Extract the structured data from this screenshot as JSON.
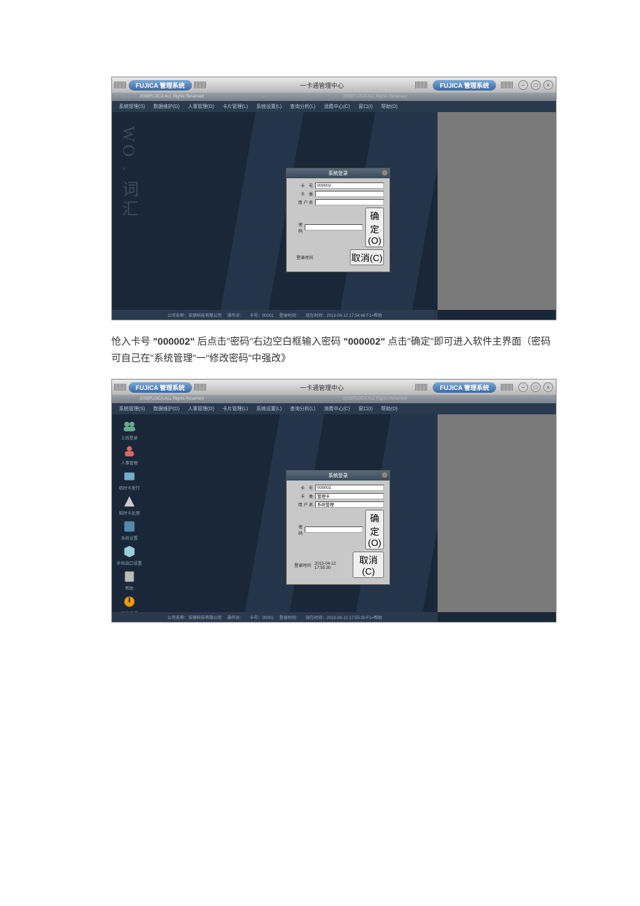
{
  "titlebar": {
    "brand_left": "FUJICA 管理系统",
    "center_title": "一卡通管理中心",
    "brand_right": "FUJICA 管理系统",
    "copyright": "2008FUJICA ALL Rights Reserved"
  },
  "menu": [
    "系统管理(S)",
    "数据维护(D)",
    "人事管理(D)",
    "卡片管理(L)",
    "系统设置(L)",
    "查询分析(L)",
    "消费中心(C)",
    "窗口(I)",
    "帮助(D)"
  ],
  "menu2": [
    "系统管理(S)",
    "数据维护(D)",
    "人事管理(D)",
    "卡片管理(L)",
    "系统设置(L)",
    "查询分析(L)",
    "消费中心(C)",
    "窗口(I)",
    "帮助(D)"
  ],
  "login": {
    "title": "系统登录",
    "fields": {
      "card_no_label": "卡　号",
      "card_no_value": "000002",
      "card_name_label": "卡　类",
      "card_name_value1": "",
      "card_name_value2": "管理卡",
      "user_label": "用 户 名",
      "user_value1": "",
      "user_value2": "系统管理",
      "pwd_label": "密　码",
      "pwd_value": "",
      "login_time_label": "登录时间",
      "login_time_value": "2013-04-12 17:55:30"
    },
    "btn_ok": "确定(O)",
    "btn_cancel": "取消(C)"
  },
  "sidebar": [
    {
      "label": "上线登录"
    },
    {
      "label": "人事管理"
    },
    {
      "label": "临时卡发行"
    },
    {
      "label": "临时卡处理"
    },
    {
      "label": "系统设置"
    },
    {
      "label": "补贴出口设置"
    },
    {
      "label": "帮助"
    },
    {
      "label": "退出系统"
    }
  ],
  "status": {
    "company": "公司名称：安德科技有限公司",
    "op": "操作员：",
    "card": "卡号：00001",
    "login": "登录时间：",
    "time": "现在时间：2013-04-12 17:54:46  F1=帮助"
  },
  "status2": {
    "company": "公司名称：安德科技有限公司",
    "op": "操作员：",
    "card": "卡号：00001",
    "login": "登录时间：",
    "time": "现在时间：2013-04-12 17:55:30  F1=帮助"
  },
  "instruction": {
    "t1": "怆入卡号",
    "v1": "\"000002\"",
    "t2": "后点击\"密码\"右边空白框输入密码",
    "v2": "\"000002\"",
    "t3": "点击\"确定\"即可进入软件主界面（密码可自己在\"系统管理\"一\"修改密码\"中强改》"
  },
  "watermark": "WO . 词汇"
}
